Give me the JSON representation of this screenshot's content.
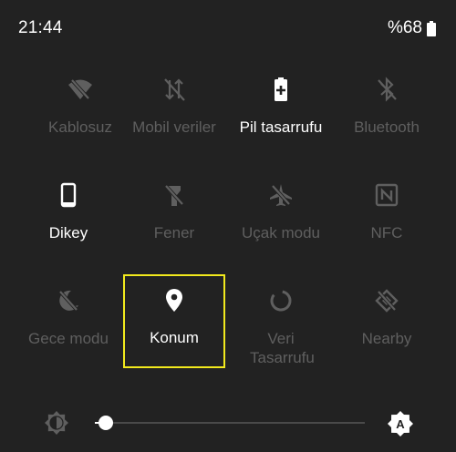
{
  "status_bar": {
    "time": "21:44",
    "battery_text": "%68",
    "battery_level": 0.68
  },
  "tiles": [
    {
      "label": "Kablosuz",
      "icon": "wifi-off-icon",
      "active": false
    },
    {
      "label": "Mobil veriler",
      "icon": "mobile-data-off-icon",
      "active": false
    },
    {
      "label": "Pil tasarrufu",
      "icon": "battery-saver-icon",
      "active": true
    },
    {
      "label": "Bluetooth",
      "icon": "bluetooth-off-icon",
      "active": false
    },
    {
      "label": "Dikey",
      "icon": "portrait-icon",
      "active": true
    },
    {
      "label": "Fener",
      "icon": "flashlight-off-icon",
      "active": false
    },
    {
      "label": "Uçak modu",
      "icon": "airplane-off-icon",
      "active": false
    },
    {
      "label": "NFC",
      "icon": "nfc-icon",
      "active": false
    },
    {
      "label": "Gece modu",
      "icon": "night-mode-off-icon",
      "active": false
    },
    {
      "label": "Konum",
      "icon": "location-pin-icon",
      "active": true,
      "highlighted": true
    },
    {
      "label": "Veri Tasarrufu",
      "icon": "data-saver-icon",
      "active": false
    },
    {
      "label": "Nearby",
      "icon": "nearby-off-icon",
      "active": false
    }
  ],
  "brightness": {
    "level": 0.02,
    "auto_label": "A"
  },
  "colors": {
    "background": "#222222",
    "active": "#ffffff",
    "inactive": "#5f5f5f",
    "highlight": "#f2ea1d"
  }
}
